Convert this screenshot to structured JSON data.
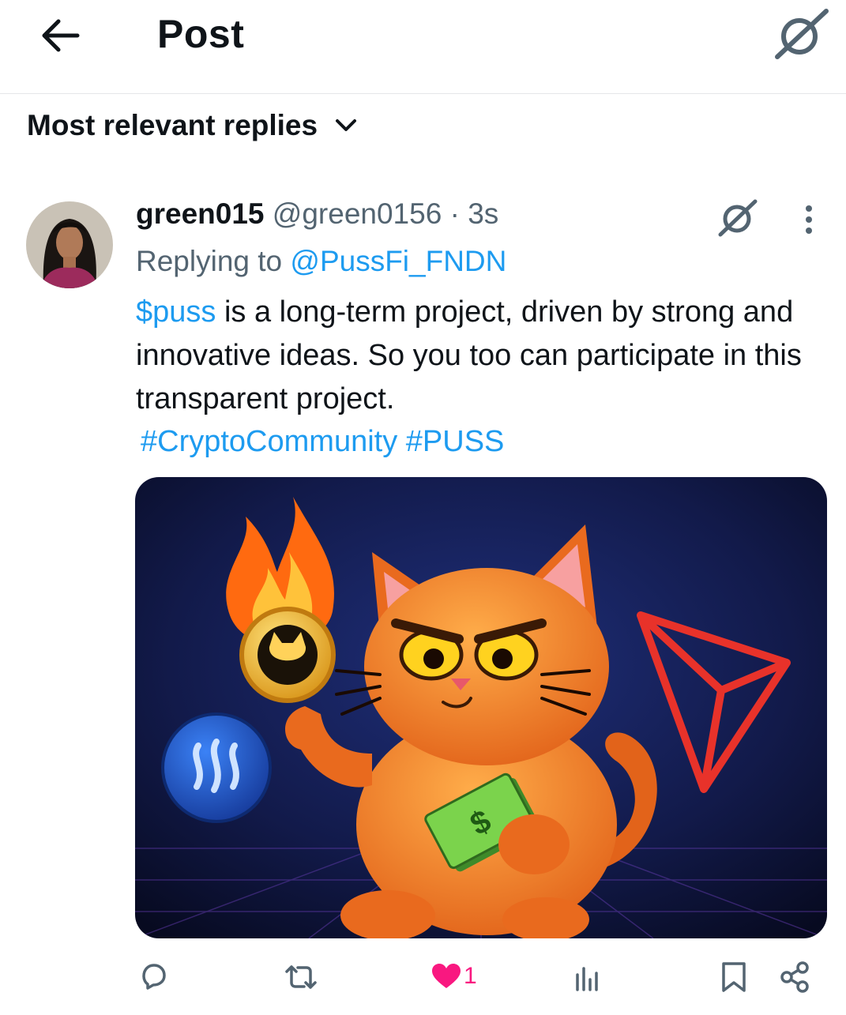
{
  "header": {
    "title": "Post"
  },
  "sort": {
    "label": "Most relevant replies"
  },
  "post": {
    "display_name": "green015",
    "handle": "@green0156",
    "separator": " · ",
    "time": "3s",
    "replying_prefix": "Replying to ",
    "replying_to": "@PussFi_FNDN",
    "cashtag": "$puss",
    "body_text": " is a long-term project, driven by strong and innovative ideas. So you too can participate in this transparent project.",
    "hashtags": [
      "#CryptoCommunity",
      "#PUSS"
    ],
    "media_alt": "",
    "likes": "1"
  },
  "icons": {
    "back": "arrow-left-icon",
    "grok": "grok-icon",
    "chevron": "chevron-down-icon",
    "more": "more-vertical-icon",
    "reply": "reply-icon",
    "repost": "repost-icon",
    "like": "heart-icon",
    "views": "views-icon",
    "bookmark": "bookmark-icon",
    "share": "share-icon"
  },
  "colors": {
    "link": "#1d9bf0",
    "like": "#f91880",
    "muted": "#536471",
    "text": "#0f1419"
  }
}
